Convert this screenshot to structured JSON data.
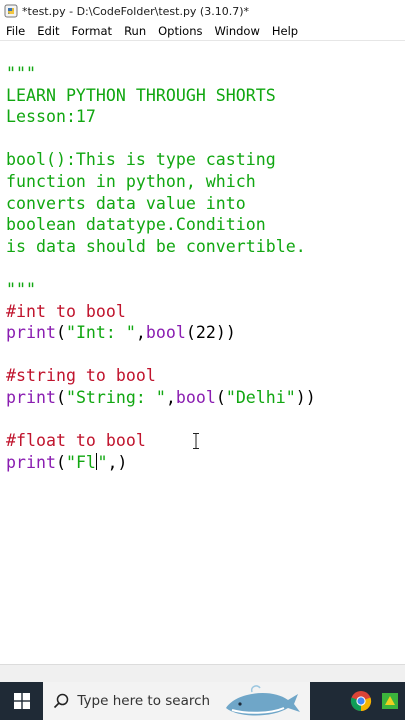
{
  "window": {
    "title": "*test.py - D:\\CodeFolder\\test.py (3.10.7)*"
  },
  "menu": [
    "File",
    "Edit",
    "Format",
    "Run",
    "Options",
    "Window",
    "Help"
  ],
  "code": {
    "line01": "\"\"\"",
    "line02": "LEARN PYTHON THROUGH SHORTS",
    "line03": "Lesson:17",
    "line05": "bool():This is type casting",
    "line06": "function in python, which",
    "line07": "converts data value into",
    "line08": "boolean datatype.Condition",
    "line09": "is data should be convertible.",
    "line11": "\"\"\"",
    "comment_int": "#int to bool",
    "print1_fn": "print",
    "print1_open": "(",
    "print1_str": "\"Int: \"",
    "print1_mid": ",",
    "print1_bool": "bool",
    "print1_rest": "(22))",
    "comment_string": "#string to bool",
    "print2_fn": "print",
    "print2_open": "(",
    "print2_str": "\"String: \"",
    "print2_mid": ",",
    "print2_bool": "bool",
    "print2_open2": "(",
    "print2_arg": "\"Delhi\"",
    "print2_close": "))",
    "comment_float": "#float to bool",
    "print3_fn": "print",
    "print3_open": "(",
    "print3_str_a": "\"Fl",
    "print3_str_b": "\"",
    "print3_rest": ",)"
  },
  "taskbar": {
    "search_placeholder": "Type here to search",
    "icons": [
      "windows-start-icon",
      "search-icon",
      "chrome-icon",
      "app-icon"
    ]
  },
  "colors": {
    "string": "#11a711",
    "comment": "#c0142d",
    "builtin": "#8a1db1",
    "keyword": "#b8860b"
  }
}
